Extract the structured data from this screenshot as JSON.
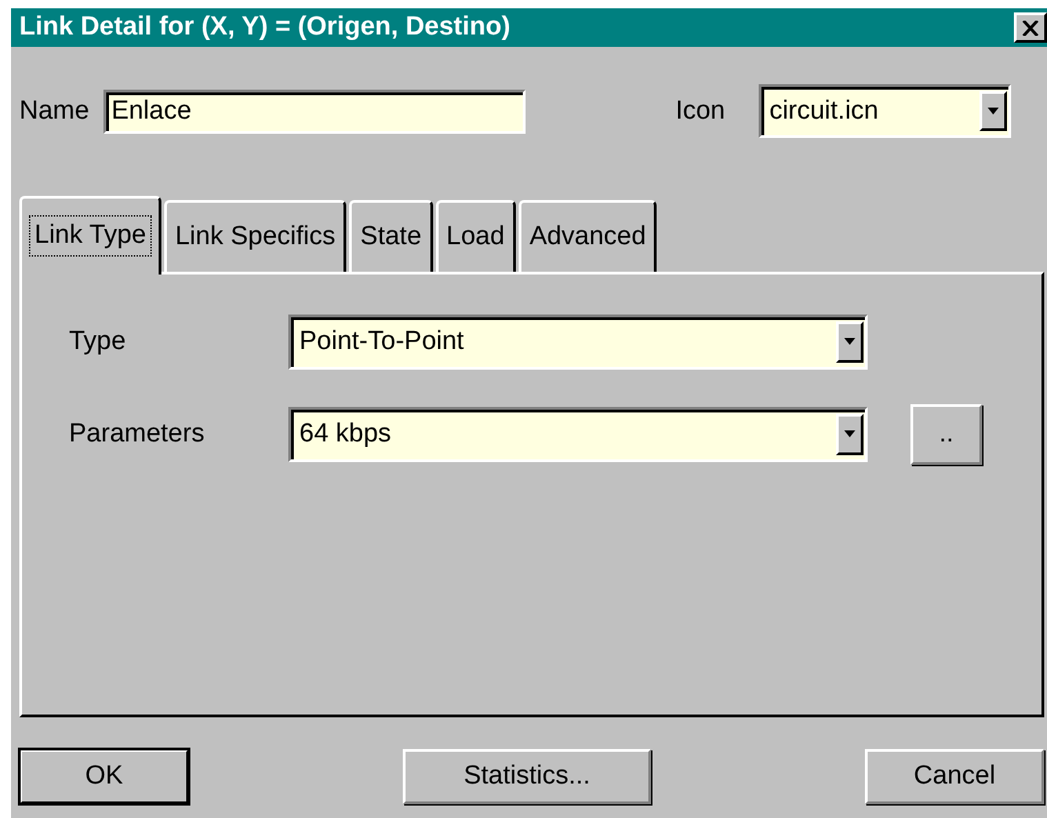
{
  "window": {
    "title": "Link Detail for (X, Y) = (Origen, Destino)"
  },
  "name_field": {
    "label": "Name",
    "value": "Enlace"
  },
  "icon_field": {
    "label": "Icon",
    "value": "circuit.icn"
  },
  "tabs": [
    {
      "label": "Link Type",
      "selected": true
    },
    {
      "label": "Link Specifics",
      "selected": false
    },
    {
      "label": "State",
      "selected": false
    },
    {
      "label": "Load",
      "selected": false
    },
    {
      "label": "Advanced",
      "selected": false
    }
  ],
  "panel": {
    "rows": [
      {
        "label": "Type",
        "value": "Point-To-Point"
      },
      {
        "label": "Parameters",
        "value": "64 kbps",
        "button": ".."
      }
    ]
  },
  "buttons": [
    {
      "label": "OK",
      "default": true
    },
    {
      "label": "Statistics...",
      "default": false
    },
    {
      "label": "Cancel",
      "default": false
    }
  ]
}
